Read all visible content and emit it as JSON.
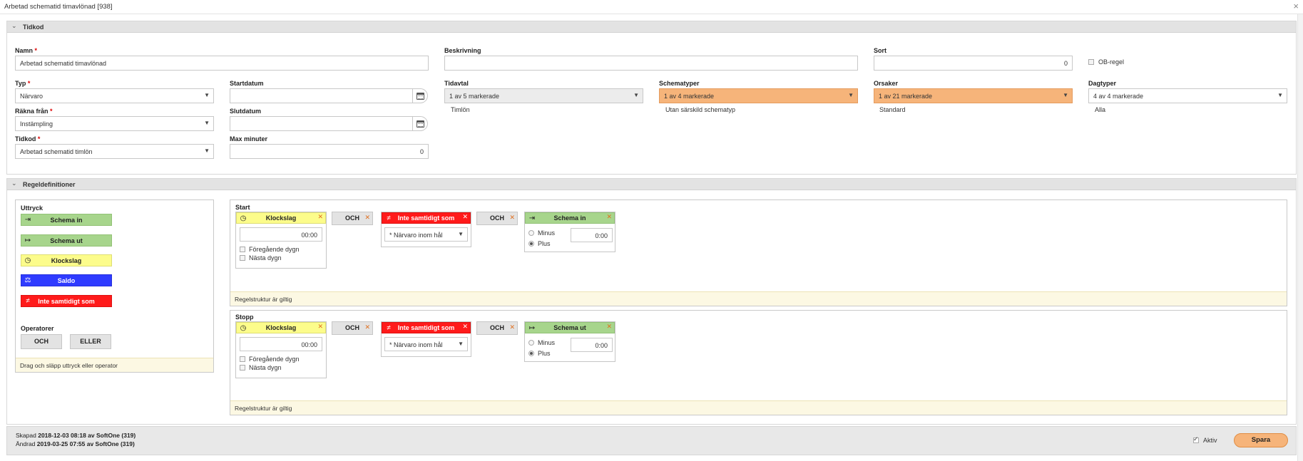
{
  "window": {
    "title": "Arbetad schematid timavlönad [938]",
    "close": "×"
  },
  "tidkod_section": {
    "title": "Tidkod",
    "namn": {
      "label": "Namn",
      "value": "Arbetad schematid timavlönad"
    },
    "beskrivning": {
      "label": "Beskrivning",
      "value": ""
    },
    "sort": {
      "label": "Sort",
      "value": "0"
    },
    "ob_regel": {
      "label": "OB-regel",
      "checked": false
    },
    "typ": {
      "label": "Typ",
      "value": "Närvaro"
    },
    "startdatum": {
      "label": "Startdatum",
      "value": ""
    },
    "tidavtal": {
      "label": "Tidavtal",
      "value": "1 av 5 markerade",
      "selected": "Timlön"
    },
    "schematyper": {
      "label": "Schematyper",
      "value": "1 av 4 markerade",
      "selected": "Utan särskild schematyp"
    },
    "orsaker": {
      "label": "Orsaker",
      "value": "1 av 21 markerade",
      "selected": "Standard"
    },
    "dagtyper": {
      "label": "Dagtyper",
      "value": "4 av 4 markerade",
      "selected": "Alla"
    },
    "rakna_fran": {
      "label": "Räkna från",
      "value": "Instämpling"
    },
    "slutdatum": {
      "label": "Slutdatum",
      "value": ""
    },
    "tidkod": {
      "label": "Tidkod",
      "value": "Arbetad schematid timlön"
    },
    "max_minuter": {
      "label": "Max minuter",
      "value": "0"
    }
  },
  "regel_section": {
    "title": "Regeldefinitioner",
    "uttryck": {
      "title": "Uttryck",
      "items": [
        {
          "label": "Schema in",
          "icon": "sign-in-icon"
        },
        {
          "label": "Schema ut",
          "icon": "sign-out-icon"
        },
        {
          "label": "Klockslag",
          "icon": "clock-icon"
        },
        {
          "label": "Saldo",
          "icon": "scale-icon"
        },
        {
          "label": "Inte samtidigt som",
          "icon": "not-equal-icon"
        }
      ],
      "operatorer_title": "Operatorer",
      "operators": [
        "OCH",
        "ELLER"
      ],
      "hint": "Drag och släpp uttryck eller operator"
    },
    "start": {
      "title": "Start",
      "klockslag": {
        "title": "Klockslag",
        "time": "00:00",
        "foregaende": "Föregående dygn",
        "nasta": "Nästa dygn"
      },
      "op1": "OCH",
      "inte": {
        "title": "Inte samtidigt som",
        "value": "* Närvaro inom hål"
      },
      "op2": "OCH",
      "schema": {
        "title": "Schema in",
        "minus": "Minus",
        "plus": "Plus",
        "time": "0:00"
      },
      "status": "Regelstruktur är giltig"
    },
    "stopp": {
      "title": "Stopp",
      "klockslag": {
        "title": "Klockslag",
        "time": "00:00",
        "foregaende": "Föregående dygn",
        "nasta": "Nästa dygn"
      },
      "op1": "OCH",
      "inte": {
        "title": "Inte samtidigt som",
        "value": "* Närvaro inom hål"
      },
      "op2": "OCH",
      "schema": {
        "title": "Schema ut",
        "minus": "Minus",
        "plus": "Plus",
        "time": "0:00"
      },
      "status": "Regelstruktur är giltig"
    }
  },
  "footer": {
    "skapad_label": "Skapad",
    "skapad_value": "2018-12-03 08:18 av SoftOne (319)",
    "andrad_label": "Ändrad",
    "andrad_value": "2019-03-25 07:55 av SoftOne (319)",
    "aktiv": "Aktiv",
    "spara": "Spara"
  },
  "colors": {
    "green": "#a7d58c",
    "yellow": "#fcfc8b",
    "blue": "#2f3bff",
    "red": "#ff1b1b",
    "orange": "#f6b47a"
  }
}
